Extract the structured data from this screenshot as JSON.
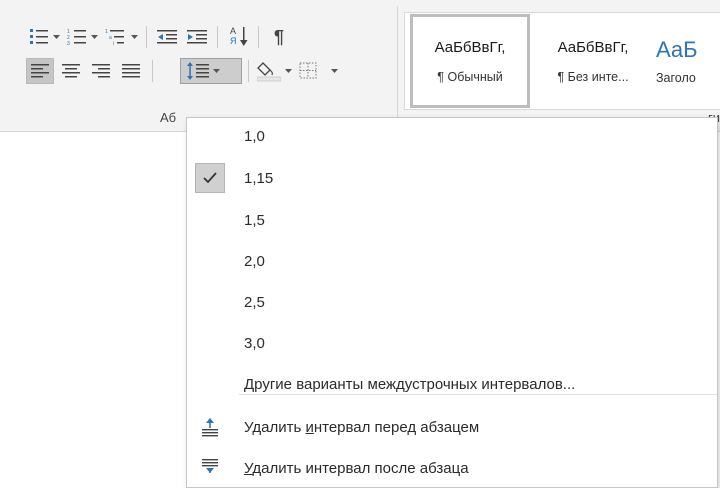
{
  "ribbon": {
    "group_label_left": "Аб",
    "group_label_right": "ги",
    "styles": [
      {
        "sample": "АаБбВвГг,",
        "name": "¶ Обычный"
      },
      {
        "sample": "АаБбВвГг,",
        "name": "¶ Без инте..."
      },
      {
        "sample": "АаБ",
        "name": "Заголо"
      }
    ],
    "icons": {
      "bullets": "bullets-icon",
      "numbering": "numbering-icon",
      "multilevel": "multilevel-list-icon",
      "decrease_indent": "decrease-indent-icon",
      "increase_indent": "increase-indent-icon",
      "sort": "sort-icon",
      "pilcrow": "show-formatting-icon",
      "align_left": "align-left-icon",
      "align_center": "align-center-icon",
      "align_right": "align-right-icon",
      "justify": "justify-icon",
      "line_spacing": "line-spacing-icon",
      "shading": "shading-icon",
      "borders": "borders-icon"
    },
    "sort_glyph_top": "А",
    "sort_glyph_bottom": "Я",
    "pilcrow_glyph": "¶"
  },
  "menu": {
    "spacing_options": [
      {
        "label": "1,0",
        "checked": false
      },
      {
        "label": "1,15",
        "checked": true
      },
      {
        "label": "1,5",
        "checked": false
      },
      {
        "label": "2,0",
        "checked": false
      },
      {
        "label": "2,5",
        "checked": false
      },
      {
        "label": "3,0",
        "checked": false
      }
    ],
    "other_options": "Другие варианты междустрочных интервалов...",
    "remove_before": {
      "pre": "Удалить ",
      "accel": "и",
      "post": "нтервал перед абзацем"
    },
    "remove_after": {
      "pre": "",
      "accel": "У",
      "post": "далить интервал после абзаца"
    }
  },
  "colors": {
    "accent_blue": "#2e74b5",
    "ribbon_bg": "#f3f3f3",
    "pressed_bg": "#c5c5c5"
  }
}
